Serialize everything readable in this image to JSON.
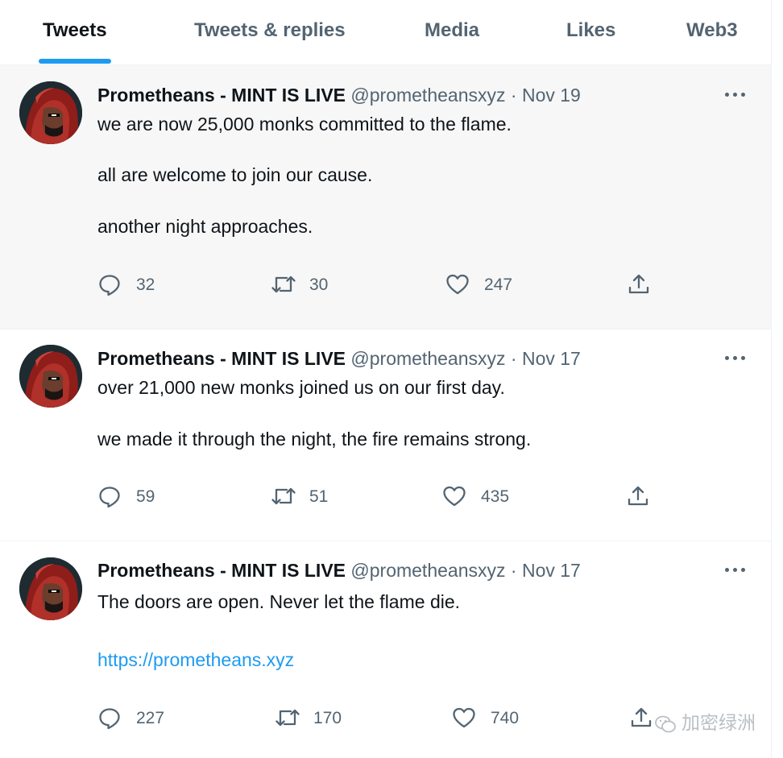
{
  "tabs": [
    {
      "label": "Tweets",
      "active": true
    },
    {
      "label": "Tweets & replies",
      "active": false
    },
    {
      "label": "Media",
      "active": false
    },
    {
      "label": "Likes",
      "active": false
    },
    {
      "label": "Web3",
      "active": false
    }
  ],
  "colors": {
    "accent": "#1d9bf0",
    "text": "#0f1419",
    "secondary": "#536471",
    "hover_bg": "#f7f7f7"
  },
  "tweets": [
    {
      "name": "Prometheans - MINT IS LIVE",
      "handle": "@prometheansxyz",
      "separator": "·",
      "date": "Nov 19",
      "lines": [
        "we are now 25,000 monks committed to the flame.",
        "all are welcome to join our cause.",
        "another night approaches."
      ],
      "replies": "32",
      "retweets": "30",
      "likes": "247"
    },
    {
      "name": "Prometheans - MINT IS LIVE",
      "handle": "@prometheansxyz",
      "separator": "·",
      "date": "Nov 17",
      "lines": [
        "over 21,000 new monks joined us on our first day.",
        "we made it through the night, the fire remains strong."
      ],
      "replies": "59",
      "retweets": "51",
      "likes": "435"
    },
    {
      "name": "Prometheans - MINT IS LIVE",
      "handle": "@prometheansxyz",
      "separator": "·",
      "date": "Nov 17",
      "lines": [
        "The doors are open. Never let the flame die."
      ],
      "link": "https://prometheans.xyz",
      "replies": "227",
      "retweets": "170",
      "likes": "740"
    }
  ],
  "icons": {
    "reply": "reply-icon",
    "retweet": "retweet-icon",
    "like": "heart-icon",
    "share": "share-icon",
    "more": "more-icon"
  },
  "watermark": "加密绿洲"
}
